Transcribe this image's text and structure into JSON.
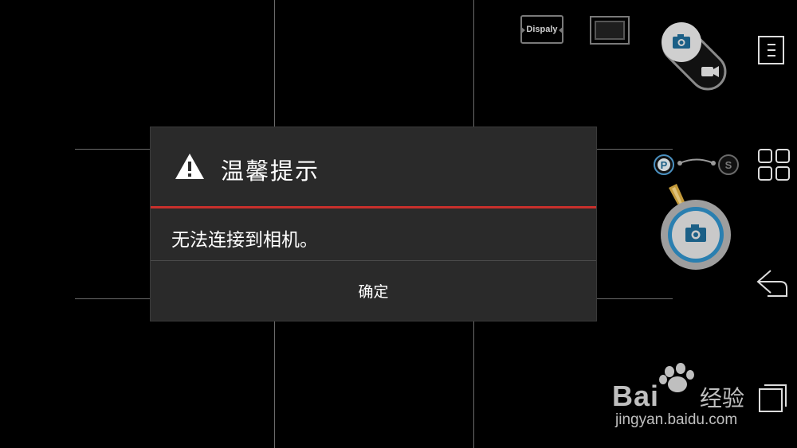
{
  "toolbar": {
    "display_label": "Dispaly",
    "exposure_modes": [
      "P",
      "S"
    ]
  },
  "dialog": {
    "title": "温馨提示",
    "message": "无法连接到相机。",
    "confirm_label": "确定",
    "accent_color": "#c8302c"
  },
  "watermark": {
    "brand": "Bai",
    "brand_cn": "经验",
    "url": "jingyan.baidu.com"
  },
  "icons": {
    "display": "display-toggle-icon",
    "frame": "frame-icon",
    "photo": "camera-icon",
    "video": "video-camera-icon",
    "menu": "menu-icon",
    "grid": "grid-view-icon",
    "back": "back-icon",
    "recent": "recent-apps-icon",
    "warning": "warning-icon"
  }
}
